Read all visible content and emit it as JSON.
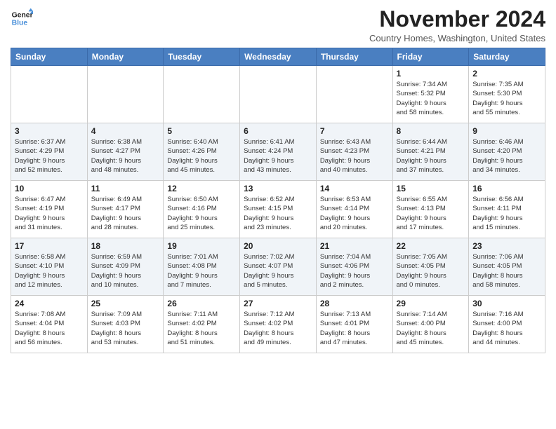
{
  "logo": {
    "line1": "General",
    "line2": "Blue"
  },
  "title": "November 2024",
  "subtitle": "Country Homes, Washington, United States",
  "days_of_week": [
    "Sunday",
    "Monday",
    "Tuesday",
    "Wednesday",
    "Thursday",
    "Friday",
    "Saturday"
  ],
  "weeks": [
    [
      {
        "day": "",
        "info": ""
      },
      {
        "day": "",
        "info": ""
      },
      {
        "day": "",
        "info": ""
      },
      {
        "day": "",
        "info": ""
      },
      {
        "day": "",
        "info": ""
      },
      {
        "day": "1",
        "info": "Sunrise: 7:34 AM\nSunset: 5:32 PM\nDaylight: 9 hours\nand 58 minutes."
      },
      {
        "day": "2",
        "info": "Sunrise: 7:35 AM\nSunset: 5:30 PM\nDaylight: 9 hours\nand 55 minutes."
      }
    ],
    [
      {
        "day": "3",
        "info": "Sunrise: 6:37 AM\nSunset: 4:29 PM\nDaylight: 9 hours\nand 52 minutes."
      },
      {
        "day": "4",
        "info": "Sunrise: 6:38 AM\nSunset: 4:27 PM\nDaylight: 9 hours\nand 48 minutes."
      },
      {
        "day": "5",
        "info": "Sunrise: 6:40 AM\nSunset: 4:26 PM\nDaylight: 9 hours\nand 45 minutes."
      },
      {
        "day": "6",
        "info": "Sunrise: 6:41 AM\nSunset: 4:24 PM\nDaylight: 9 hours\nand 43 minutes."
      },
      {
        "day": "7",
        "info": "Sunrise: 6:43 AM\nSunset: 4:23 PM\nDaylight: 9 hours\nand 40 minutes."
      },
      {
        "day": "8",
        "info": "Sunrise: 6:44 AM\nSunset: 4:21 PM\nDaylight: 9 hours\nand 37 minutes."
      },
      {
        "day": "9",
        "info": "Sunrise: 6:46 AM\nSunset: 4:20 PM\nDaylight: 9 hours\nand 34 minutes."
      }
    ],
    [
      {
        "day": "10",
        "info": "Sunrise: 6:47 AM\nSunset: 4:19 PM\nDaylight: 9 hours\nand 31 minutes."
      },
      {
        "day": "11",
        "info": "Sunrise: 6:49 AM\nSunset: 4:17 PM\nDaylight: 9 hours\nand 28 minutes."
      },
      {
        "day": "12",
        "info": "Sunrise: 6:50 AM\nSunset: 4:16 PM\nDaylight: 9 hours\nand 25 minutes."
      },
      {
        "day": "13",
        "info": "Sunrise: 6:52 AM\nSunset: 4:15 PM\nDaylight: 9 hours\nand 23 minutes."
      },
      {
        "day": "14",
        "info": "Sunrise: 6:53 AM\nSunset: 4:14 PM\nDaylight: 9 hours\nand 20 minutes."
      },
      {
        "day": "15",
        "info": "Sunrise: 6:55 AM\nSunset: 4:13 PM\nDaylight: 9 hours\nand 17 minutes."
      },
      {
        "day": "16",
        "info": "Sunrise: 6:56 AM\nSunset: 4:11 PM\nDaylight: 9 hours\nand 15 minutes."
      }
    ],
    [
      {
        "day": "17",
        "info": "Sunrise: 6:58 AM\nSunset: 4:10 PM\nDaylight: 9 hours\nand 12 minutes."
      },
      {
        "day": "18",
        "info": "Sunrise: 6:59 AM\nSunset: 4:09 PM\nDaylight: 9 hours\nand 10 minutes."
      },
      {
        "day": "19",
        "info": "Sunrise: 7:01 AM\nSunset: 4:08 PM\nDaylight: 9 hours\nand 7 minutes."
      },
      {
        "day": "20",
        "info": "Sunrise: 7:02 AM\nSunset: 4:07 PM\nDaylight: 9 hours\nand 5 minutes."
      },
      {
        "day": "21",
        "info": "Sunrise: 7:04 AM\nSunset: 4:06 PM\nDaylight: 9 hours\nand 2 minutes."
      },
      {
        "day": "22",
        "info": "Sunrise: 7:05 AM\nSunset: 4:05 PM\nDaylight: 9 hours\nand 0 minutes."
      },
      {
        "day": "23",
        "info": "Sunrise: 7:06 AM\nSunset: 4:05 PM\nDaylight: 8 hours\nand 58 minutes."
      }
    ],
    [
      {
        "day": "24",
        "info": "Sunrise: 7:08 AM\nSunset: 4:04 PM\nDaylight: 8 hours\nand 56 minutes."
      },
      {
        "day": "25",
        "info": "Sunrise: 7:09 AM\nSunset: 4:03 PM\nDaylight: 8 hours\nand 53 minutes."
      },
      {
        "day": "26",
        "info": "Sunrise: 7:11 AM\nSunset: 4:02 PM\nDaylight: 8 hours\nand 51 minutes."
      },
      {
        "day": "27",
        "info": "Sunrise: 7:12 AM\nSunset: 4:02 PM\nDaylight: 8 hours\nand 49 minutes."
      },
      {
        "day": "28",
        "info": "Sunrise: 7:13 AM\nSunset: 4:01 PM\nDaylight: 8 hours\nand 47 minutes."
      },
      {
        "day": "29",
        "info": "Sunrise: 7:14 AM\nSunset: 4:00 PM\nDaylight: 8 hours\nand 45 minutes."
      },
      {
        "day": "30",
        "info": "Sunrise: 7:16 AM\nSunset: 4:00 PM\nDaylight: 8 hours\nand 44 minutes."
      }
    ]
  ]
}
